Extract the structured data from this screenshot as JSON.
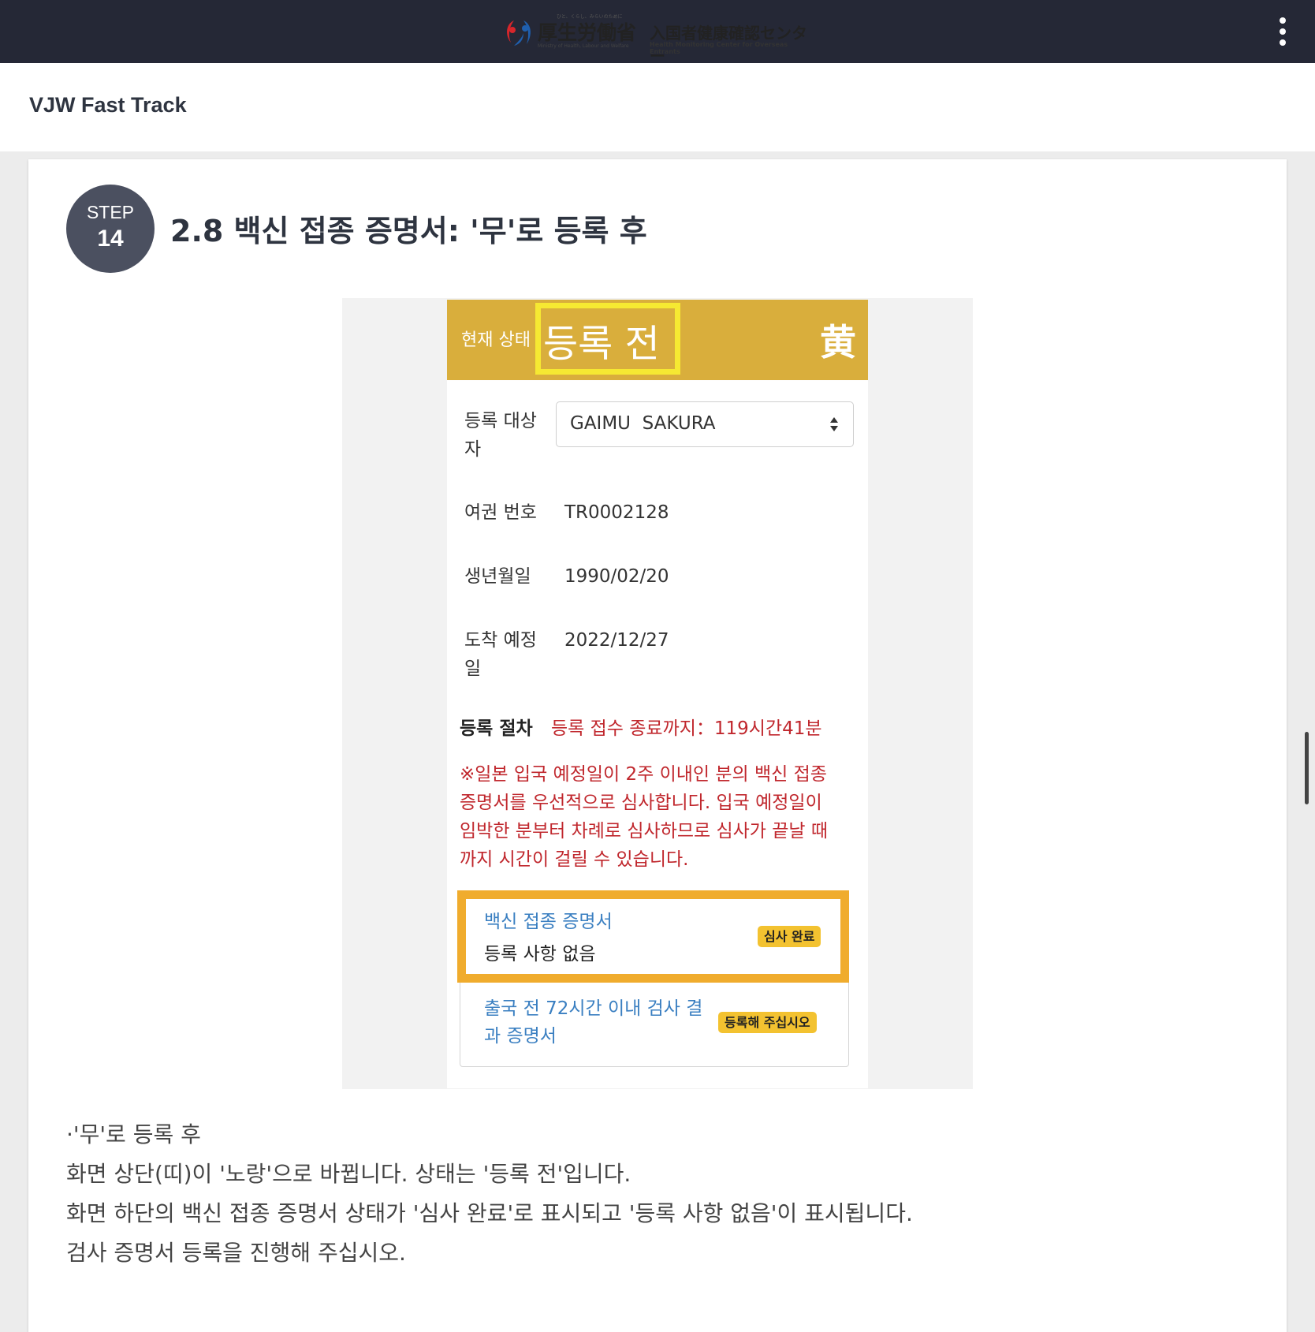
{
  "header": {
    "logo": {
      "ministry_tagline": "ひと、くらし、みらいのために",
      "ministry_name": "厚生労働省",
      "ministry_en": "Ministry of Health, Labour and Welfare",
      "center_name": "入国者健康確認センター",
      "center_en": "Health Monitoring Center for Overseas Entrants"
    },
    "menu_icon": "kebab-menu-icon"
  },
  "app_title": "VJW Fast Track",
  "step": {
    "label": "STEP",
    "number": "14",
    "title": "2.8 백신 접종 증명서: '무'로 등록 후"
  },
  "screenshot": {
    "status": {
      "caption": "현재 상태",
      "value": "등록 전",
      "kanji": "黄",
      "band_color": "#d9ae3c",
      "highlight_color": "#f6e932"
    },
    "registrant": {
      "label": "등록 대상자",
      "value": "GAIMU  SAKURA"
    },
    "passport": {
      "label": "여권 번호",
      "value": "TR0002128"
    },
    "birthdate": {
      "label": "생년월일",
      "value": "1990/02/20"
    },
    "arrival": {
      "label": "도착 예정일",
      "value": "2022/12/27"
    },
    "procedure": {
      "label": "등록 절차",
      "deadline": "등록 접수 종료까지：119시간41분"
    },
    "notice_lines": [
      "※일본 입국 예정일이 2주 이내인 분의 백신 접종",
      "증명서를 우선적으로 심사합니다. 입국 예정일이",
      "임박한 분부터 차례로 심사하므로 심사가 끝날 때",
      "까지 시간이 걸릴 수 있습니다."
    ],
    "items": [
      {
        "title": "백신 접종 증명서",
        "subtitle": "등록 사항 없음",
        "badge": "심사 완료"
      },
      {
        "title_lines": [
          "출국 전 72시간 이내 검사 결",
          "과 증명서"
        ],
        "badge": "등록해 주십시오"
      }
    ],
    "item_highlight_color": "#f0ac2d",
    "badge_color": "#f3c230"
  },
  "description": [
    "·'무'로 등록 후",
    "화면 상단(띠)이 '노랑'으로 바뀝니다. 상태는 '등록 전'입니다.",
    "화면 하단의 백신 접종 증명서 상태가 '심사 완료'로 표시되고 '등록 사항 없음'이 표시됩니다.",
    "검사 증명서 등록을 진행해 주십시오."
  ]
}
